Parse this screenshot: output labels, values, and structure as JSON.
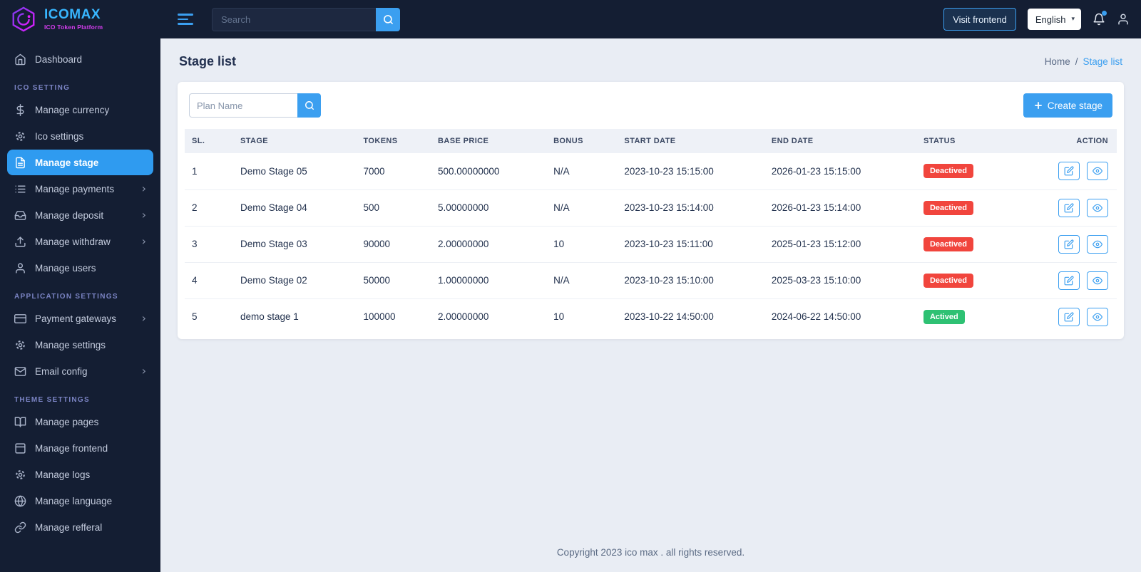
{
  "brand": {
    "name": "ICOMAX",
    "tagline": "ICO Token Platform"
  },
  "header": {
    "search_placeholder": "Search",
    "visit_frontend_label": "Visit frontend",
    "language": "English",
    "caret": "▾"
  },
  "sidebar": {
    "sections": [
      {
        "label": "",
        "items": [
          {
            "label": "Dashboard"
          }
        ]
      },
      {
        "label": "ICO SETTING",
        "items": [
          {
            "label": "Manage currency"
          },
          {
            "label": "Ico settings"
          },
          {
            "label": "Manage stage"
          },
          {
            "label": "Manage payments"
          },
          {
            "label": "Manage deposit"
          },
          {
            "label": "Manage withdraw"
          },
          {
            "label": "Manage users"
          }
        ]
      },
      {
        "label": "APPLICATION SETTINGS",
        "items": [
          {
            "label": "Payment gateways"
          },
          {
            "label": "Manage settings"
          },
          {
            "label": "Email config"
          }
        ]
      },
      {
        "label": "THEME SETTINGS",
        "items": [
          {
            "label": "Manage pages"
          },
          {
            "label": "Manage frontend"
          },
          {
            "label": "Manage logs"
          },
          {
            "label": "Manage language"
          },
          {
            "label": "Manage refferal"
          }
        ]
      }
    ],
    "chevron": "›"
  },
  "page": {
    "title": "Stage list",
    "breadcrumb_home": "Home",
    "breadcrumb_sep": "/",
    "breadcrumb_current": "Stage list"
  },
  "toolbar": {
    "filter_placeholder": "Plan Name",
    "create_label": "Create stage"
  },
  "table": {
    "headers": [
      "SL.",
      "STAGE",
      "TOKENS",
      "BASE PRICE",
      "BONUS",
      "START DATE",
      "END DATE",
      "STATUS",
      "ACTION"
    ],
    "rows": [
      {
        "sl": "1",
        "stage": "Demo Stage 05",
        "tokens": "7000",
        "base_price": "500.00000000",
        "bonus": "N/A",
        "start_date": "2023-10-23 15:15:00",
        "end_date": "2026-01-23 15:15:00",
        "status": "Deactived",
        "status_type": "danger"
      },
      {
        "sl": "2",
        "stage": "Demo Stage 04",
        "tokens": "500",
        "base_price": "5.00000000",
        "bonus": "N/A",
        "start_date": "2023-10-23 15:14:00",
        "end_date": "2026-01-23 15:14:00",
        "status": "Deactived",
        "status_type": "danger"
      },
      {
        "sl": "3",
        "stage": "Demo Stage 03",
        "tokens": "90000",
        "base_price": "2.00000000",
        "bonus": "10",
        "start_date": "2023-10-23 15:11:00",
        "end_date": "2025-01-23 15:12:00",
        "status": "Deactived",
        "status_type": "danger"
      },
      {
        "sl": "4",
        "stage": "Demo Stage 02",
        "tokens": "50000",
        "base_price": "1.00000000",
        "bonus": "N/A",
        "start_date": "2023-10-23 15:10:00",
        "end_date": "2025-03-23 15:10:00",
        "status": "Deactived",
        "status_type": "danger"
      },
      {
        "sl": "5",
        "stage": "demo stage 1",
        "tokens": "100000",
        "base_price": "2.00000000",
        "bonus": "10",
        "start_date": "2023-10-22 14:50:00",
        "end_date": "2024-06-22 14:50:00",
        "status": "Actived",
        "status_type": "success"
      }
    ]
  },
  "footer": {
    "copyright": "Copyright 2023 ico max . all rights reserved."
  },
  "colors": {
    "accent": "#3b9ff0",
    "danger": "#f1453d",
    "success": "#2ec173",
    "sidebar_bg": "#141e33",
    "content_bg": "#e9edf4",
    "brand_blue": "#38b6ff",
    "brand_magenta": "#d63df0",
    "active_item_bg": "#2f9bf0"
  }
}
